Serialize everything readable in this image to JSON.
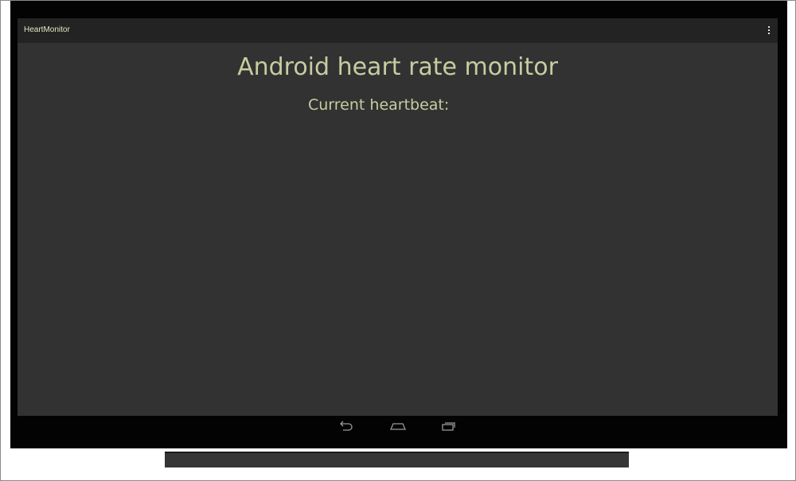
{
  "app": {
    "title": "HeartMonitor"
  },
  "action_bar": {
    "overflow_icon": "overflow-menu-icon"
  },
  "main": {
    "headline": "Android heart rate monitor",
    "heartbeat_label": "Current heartbeat:"
  },
  "navigation": {
    "buttons": [
      "back-icon",
      "home-icon",
      "recents-icon"
    ]
  },
  "colors": {
    "screen_background": "#323232",
    "action_bar_background": "#232323",
    "text_accent": "#c8cca0",
    "bezel": "#030303"
  }
}
